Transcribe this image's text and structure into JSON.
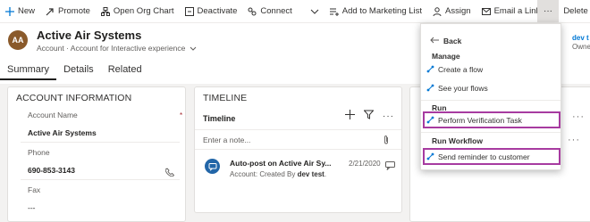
{
  "toolbar": {
    "new": "New",
    "promote": "Promote",
    "open_org_chart": "Open Org Chart",
    "deactivate": "Deactivate",
    "connect": "Connect",
    "add_to_marketing_list": "Add to Marketing List",
    "assign": "Assign",
    "email_link": "Email a Link",
    "delete": "Delete",
    "more": "···"
  },
  "record": {
    "avatar_initials": "AA",
    "title": "Active Air Systems",
    "subtitle": "Account · Account for Interactive experience",
    "owner_name": "dev t",
    "owner_role": "Owne"
  },
  "tabs": [
    "Summary",
    "Details",
    "Related"
  ],
  "account_info": {
    "title": "ACCOUNT INFORMATION",
    "fields": [
      {
        "label": "Account Name",
        "value": "Active Air Systems",
        "required": "*"
      },
      {
        "label": "Phone",
        "value": "690-853-3143"
      },
      {
        "label": "Fax",
        "value": "---"
      }
    ]
  },
  "timeline": {
    "title": "TIMELINE",
    "header": "Timeline",
    "note_placeholder": "Enter a note...",
    "post_title": "Auto-post on Active Air Sy...",
    "post_sub_prefix": "Account: Created By ",
    "post_sub_user": "dev test",
    "post_sub_suffix": ".",
    "post_date": "2/21/2020"
  },
  "flyout": {
    "back": "Back",
    "manage_label": "Manage",
    "manage_items": [
      "Create a flow",
      "See your flows"
    ],
    "run_label": "Run",
    "run_items": [
      "Perform Verification Task"
    ],
    "workflow_label": "Run Workflow",
    "workflow_items": [
      "Send reminder to customer"
    ]
  },
  "colors": {
    "accent": "#0078d4",
    "highlight": "#a73ba0",
    "avatar": "#8a5a2b"
  }
}
